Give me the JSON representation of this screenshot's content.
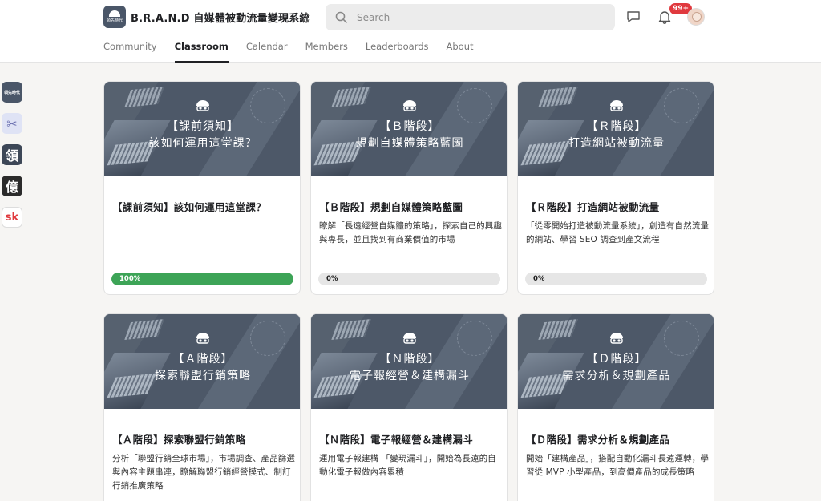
{
  "header": {
    "logo_text": "領先時代",
    "group_name": "B.R.A.N.D 自媒體被動流量變現系統",
    "search_placeholder": "Search",
    "notification_count": "99+"
  },
  "tabs": [
    {
      "label": "Community",
      "active": false
    },
    {
      "label": "Classroom",
      "active": true
    },
    {
      "label": "Calendar",
      "active": false
    },
    {
      "label": "Members",
      "active": false
    },
    {
      "label": "Leaderboards",
      "active": false
    },
    {
      "label": "About",
      "active": false
    }
  ],
  "rail": [
    {
      "label": "領先時代",
      "bg": "#4a5668",
      "fg": "#ffffff"
    },
    {
      "label": "✂",
      "bg": "#dfe3f5",
      "fg": "#6a6fb0"
    },
    {
      "label": "領",
      "bg": "#3d4757",
      "fg": "#ffffff"
    },
    {
      "label": "億",
      "bg": "#2b2b2b",
      "fg": "#ffffff"
    },
    {
      "label": "sk",
      "bg": "#ffffff",
      "fg": "#e0393e"
    }
  ],
  "courses": [
    {
      "banner_line1": "【課前須知】",
      "banner_line2": "該如何運用這堂課？",
      "title": "【課前須知】該如何運用這堂課？",
      "description": "",
      "progress": 100,
      "progress_label": "100%"
    },
    {
      "banner_line1": "【Ｂ階段】",
      "banner_line2": "規劃自媒體策略藍圖",
      "title": "【Ｂ階段】規劃自媒體策略藍圖",
      "description": "瞭解「長遠經營自媒體的策略」，探索自己的興趣與專長，並且找到有商業價值的市場",
      "progress": 0,
      "progress_label": "0%"
    },
    {
      "banner_line1": "【Ｒ階段】",
      "banner_line2": "打造網站被動流量",
      "title": "【Ｒ階段】打造網站被動流量",
      "description": "「從零開始打造被動流量系統」，創造有自然流量的網站、學習 SEO 調查到產文流程",
      "progress": 0,
      "progress_label": "0%"
    },
    {
      "banner_line1": "【Ａ階段】",
      "banner_line2": "探索聯盟行銷策略",
      "title": "【Ａ階段】探索聯盟行銷策略",
      "description": "分析「聯盟行銷全球市場」，市場調查、產品篩選與內容主題串連，瞭解聯盟行銷經營模式、制訂行銷推廣策略",
      "progress": null,
      "progress_label": ""
    },
    {
      "banner_line1": "【Ｎ階段】",
      "banner_line2": "電子報經營＆建構漏斗",
      "title": "【Ｎ階段】電子報經營＆建構漏斗",
      "description": "運用電子報建構 「變現漏斗」，開始為長遠的自動化電子報做內容累積",
      "progress": null,
      "progress_label": ""
    },
    {
      "banner_line1": "【Ｄ階段】",
      "banner_line2": "需求分析＆規劃產品",
      "title": "【Ｄ階段】需求分析＆規劃產品",
      "description": "開始「建構產品」，搭配自動化漏斗長遠運轉，學習從 MVP 小型產品，到高價產品的成長策略",
      "progress": null,
      "progress_label": ""
    }
  ],
  "colors": {
    "banner_bg": "#4d5868",
    "progress_fill": "#3da457",
    "badge": "#e0393e"
  },
  "icons": [
    "search-icon",
    "chat-icon",
    "bell-icon",
    "chevron-up-down-icon",
    "mascot-icon"
  ]
}
